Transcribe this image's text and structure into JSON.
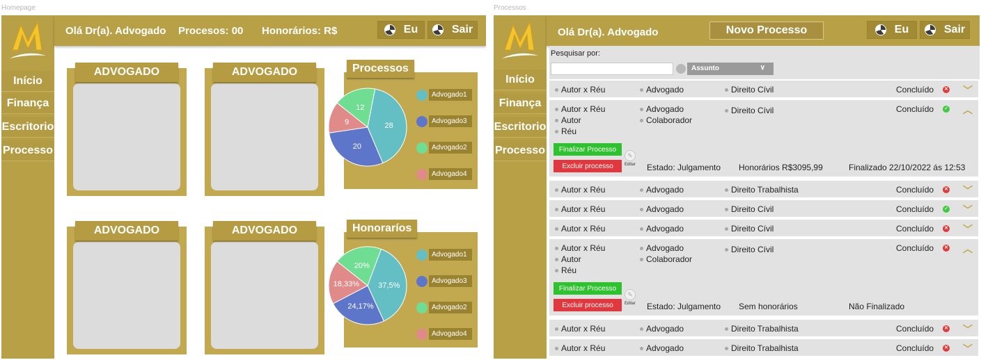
{
  "frames": {
    "home_label": "Homepage",
    "proc_label": "Processos"
  },
  "sidebar": {
    "items": [
      {
        "label": "Início"
      },
      {
        "label": "Finança"
      },
      {
        "label": "Escritorio"
      },
      {
        "label": "Processo"
      }
    ]
  },
  "home": {
    "greeting": "Olá Dr(a). Advogado",
    "processos_text": "Procesos: 00",
    "honorarios_text": "Honorários: R$",
    "me_label": "Eu",
    "logout_label": "Sair",
    "cards": [
      "ADVOGADO",
      "ADVOGADO",
      "ADVOGADO",
      "ADVOGADO"
    ]
  },
  "chart_data": [
    {
      "type": "pie",
      "title": "Processos",
      "slices": [
        {
          "label": "12",
          "value": 12,
          "color": "#6fde93"
        },
        {
          "label": "28",
          "value": 28,
          "color": "#63bfc4"
        },
        {
          "label": "20",
          "value": 20,
          "color": "#5e76c9"
        },
        {
          "label": "9",
          "value": 9,
          "color": "#e08a8a"
        }
      ],
      "legend": [
        {
          "name": "Advogado1",
          "color": "#63bfc4"
        },
        {
          "name": "Advogado3",
          "color": "#5e76c9"
        },
        {
          "name": "Advogado2",
          "color": "#6fde93"
        },
        {
          "name": "Advogado4",
          "color": "#e08a8a"
        }
      ]
    },
    {
      "type": "pie",
      "title": "Honoraríos",
      "slices": [
        {
          "label": "20%",
          "value": 20,
          "color": "#6fde93"
        },
        {
          "label": "37,5%",
          "value": 37.5,
          "color": "#63bfc4"
        },
        {
          "label": "24,17%",
          "value": 24.17,
          "color": "#5e76c9"
        },
        {
          "label": "18,33%",
          "value": 18.33,
          "color": "#e08a8a"
        }
      ],
      "legend": [
        {
          "name": "Advogado1",
          "color": "#63bfc4"
        },
        {
          "name": "Advogado3",
          "color": "#5e76c9"
        },
        {
          "name": "Advogado2",
          "color": "#6fde93"
        },
        {
          "name": "Advogado4",
          "color": "#e08a8a"
        }
      ]
    }
  ],
  "proc": {
    "greeting": "Olá Dr(a). Advogado",
    "new_process": "Novo Processo",
    "me_label": "Eu",
    "logout_label": "Sair",
    "search_label": "Pesquisar por:",
    "search_value": "",
    "select_value": "Assunto",
    "rows": [
      {
        "parties": "Autor x Réu",
        "lawyer": "Advogado",
        "area": "Direito Cívil",
        "status": "Concluído",
        "ok": false,
        "expanded": false
      },
      {
        "parties": "Autor x Réu",
        "lawyer": "Advogado",
        "area": "Direito Cívil",
        "status": "Concluído",
        "ok": true,
        "expanded": true,
        "autor": "Autor",
        "reu": "Réu",
        "colab": "Colaborador",
        "finalize": "Finalizar Processo",
        "delete": "Excluir processo",
        "edit": "Editar",
        "estado": "Estado: Julgamento",
        "honorarios": "Honorários R$3095,99",
        "finalizado": "Finalizado 22/10/2022 ás 12:53"
      },
      {
        "parties": "Autor x Réu",
        "lawyer": "Advogado",
        "area": "Direito Trabalhista",
        "status": "Concluído",
        "ok": false,
        "expanded": false
      },
      {
        "parties": "Autor x Réu",
        "lawyer": "Advogado",
        "area": "Direito Cívil",
        "status": "Concluído",
        "ok": true,
        "expanded": false
      },
      {
        "parties": "Autor x Réu",
        "lawyer": "Advogado",
        "area": "Direito Cívil",
        "status": "Concluído",
        "ok": false,
        "expanded": false
      },
      {
        "parties": "Autor x Réu",
        "lawyer": "Advogado",
        "area": "Direito Cívil",
        "status": "Concluído",
        "ok": false,
        "expanded": true,
        "autor": "Autor",
        "reu": "Réu",
        "colab": "Colaborador",
        "finalize": "Finalizar Processo",
        "delete": "Excluir processo",
        "edit": "Editar",
        "estado": "Estado: Julgamento",
        "honorarios": "Sem honorários",
        "finalizado": "Não Finalizado"
      },
      {
        "parties": "Autor x Réu",
        "lawyer": "Advogado",
        "area": "Direito Trabalhista",
        "status": "Concluído",
        "ok": false,
        "expanded": false
      },
      {
        "parties": "Autor x Réu",
        "lawyer": "Advogado",
        "area": "Direito Trabalhista",
        "status": "Concluído",
        "ok": false,
        "expanded": false
      }
    ]
  },
  "colors": {
    "gold": "#b8a047",
    "gold_dark": "#9a8330",
    "panel": "#e2e2e2"
  }
}
